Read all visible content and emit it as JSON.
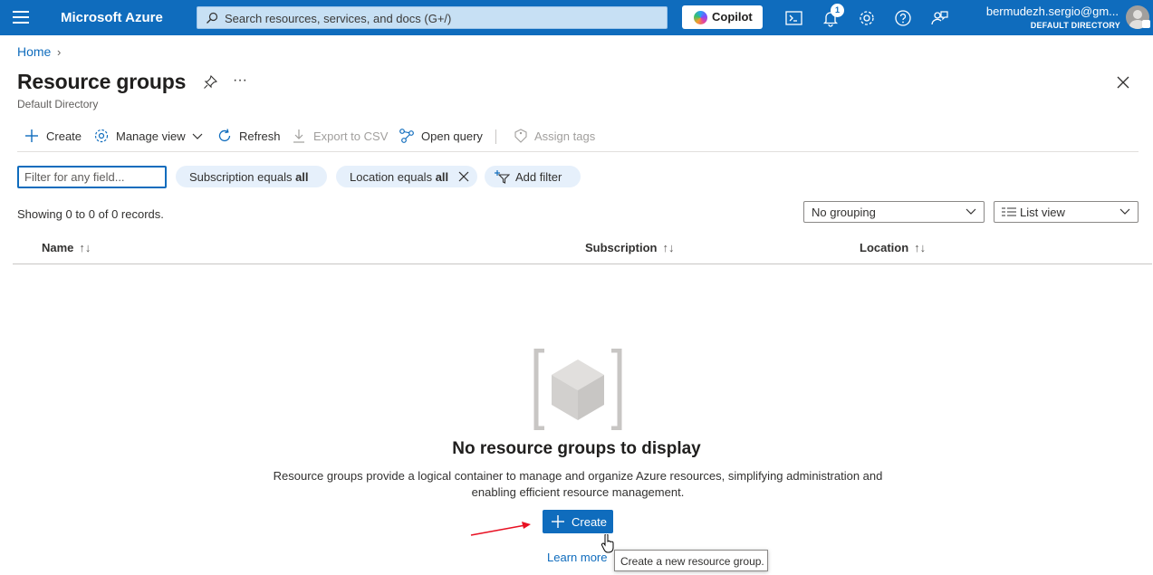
{
  "topbar": {
    "brand": "Microsoft Azure",
    "search_placeholder": "Search resources, services, and docs (G+/)",
    "copilot_label": "Copilot",
    "notification_count": "1",
    "user_email": "bermudezh.sergio@gm...",
    "user_directory": "DEFAULT DIRECTORY",
    "icons": [
      "hamburger-icon",
      "search-icon",
      "cloud-shell-icon",
      "bell-icon",
      "gear-icon",
      "help-icon",
      "feedback-icon"
    ]
  },
  "breadcrumb": {
    "home": "Home"
  },
  "page": {
    "title": "Resource groups",
    "subtitle": "Default Directory"
  },
  "commands": {
    "create": "Create",
    "manage_view": "Manage view",
    "refresh": "Refresh",
    "export_csv": "Export to CSV",
    "open_query": "Open query",
    "assign_tags": "Assign tags"
  },
  "filters": {
    "input_placeholder": "Filter for any field...",
    "subscription_prefix": "Subscription equals ",
    "subscription_value": "all",
    "location_prefix": "Location equals ",
    "location_value": "all",
    "add_filter": "Add filter"
  },
  "status": {
    "showing": "Showing 0 to 0 of 0 records."
  },
  "view_controls": {
    "grouping": "No grouping",
    "view": "List view"
  },
  "table": {
    "columns": [
      "Name",
      "Subscription",
      "Location"
    ]
  },
  "empty_state": {
    "title": "No resource groups to display",
    "description": "Resource groups provide a logical container to manage and organize Azure resources, simplifying administration and enabling efficient resource management.",
    "create_label": "Create",
    "learn_more": "Learn more",
    "tooltip": "Create a new resource group."
  },
  "colors": {
    "accent": "#0f6cbd",
    "pill_bg": "#e6f0fb",
    "annotation_arrow": "#e81123"
  }
}
